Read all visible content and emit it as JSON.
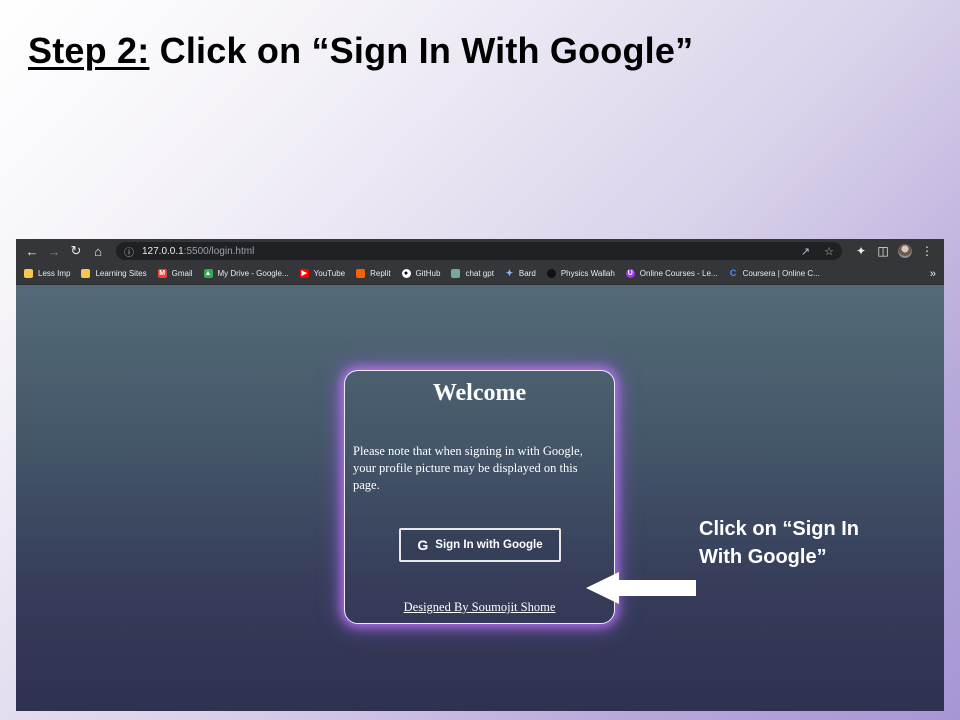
{
  "slide": {
    "step_label": "Step 2:",
    "title_rest": " Click on “Sign In With Google”"
  },
  "browser": {
    "url_host": "127.0.0.1",
    "url_path": ":5500/login.html",
    "bookmarks": [
      {
        "label": "Less Imp",
        "icon": "folder-icon",
        "color": "#f9c74f"
      },
      {
        "label": "Learning Sites",
        "icon": "folder-icon",
        "color": "#f9c74f"
      },
      {
        "label": "Gmail",
        "icon": "gmail-icon",
        "color": "#ea4335"
      },
      {
        "label": "My Drive - Google...",
        "icon": "drive-icon",
        "color": "#34a853"
      },
      {
        "label": "YouTube",
        "icon": "youtube-icon",
        "color": "#ff0000"
      },
      {
        "label": "Replit",
        "icon": "replit-icon",
        "color": "#f26207"
      },
      {
        "label": "GitHub",
        "icon": "github-icon",
        "color": "#ffffff"
      },
      {
        "label": "chat gpt",
        "icon": "chatgpt-icon",
        "color": "#74aa9c"
      },
      {
        "label": "Bard",
        "icon": "bard-icon",
        "color": "#8ab4f8"
      },
      {
        "label": "Physics Wallah",
        "icon": "pw-icon",
        "color": "#222222"
      },
      {
        "label": "Online Courses - Le...",
        "icon": "udemy-icon",
        "color": "#a435f0"
      },
      {
        "label": "Coursera | Online C...",
        "icon": "coursera-icon",
        "color": "#0056d2"
      }
    ],
    "more": "»"
  },
  "login": {
    "heading": "Welcome",
    "note": "Please note that when signing in with Google, your profile picture may be displayed on this page.",
    "button_label": "Sign In with Google",
    "footer": "Designed By Soumojit Shome"
  },
  "callout": {
    "line1": "Click on “Sign In",
    "line2": "With Google”"
  },
  "colors": {
    "glow": "#b57cff",
    "slide_gradient_end": "#a796d4"
  }
}
